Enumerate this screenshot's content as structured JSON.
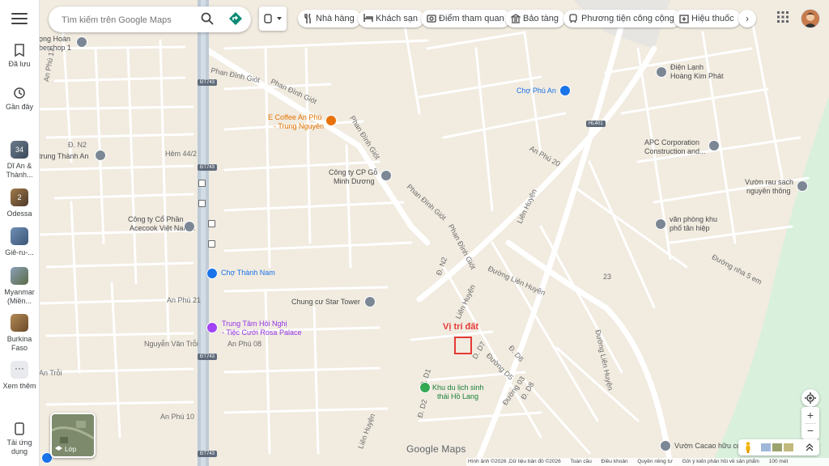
{
  "search": {
    "placeholder": "Tìm kiếm trên Google Maps"
  },
  "rail": {
    "saved": "Đã lưu",
    "recent": "Gần đây",
    "places": [
      {
        "label": "Dĩ An & Thành...",
        "badge": "34"
      },
      {
        "label": "Odessa",
        "badge": "2"
      },
      {
        "label": "Giê-ru-...",
        "badge": ""
      },
      {
        "label": "Myanmar (Miền...",
        "badge": ""
      },
      {
        "label": "Burkina Faso",
        "badge": ""
      }
    ],
    "more": "Xem thêm",
    "download": "Tải ứng dụng"
  },
  "chips": [
    {
      "label": "Nhà hàng",
      "icon": "restaurant-icon"
    },
    {
      "label": "Khách sạn",
      "icon": "hotel-icon"
    },
    {
      "label": "Điểm tham quan",
      "icon": "camera-icon"
    },
    {
      "label": "Bảo tàng",
      "icon": "museum-icon"
    },
    {
      "label": "Phương tiện công cộng",
      "icon": "transit-icon"
    },
    {
      "label": "Hiệu thuốc",
      "icon": "pharmacy-icon"
    }
  ],
  "map_labels": {
    "hoan": "ọng Hoàn",
    "barbershop": "bershop 1",
    "anphu17": "An Phú 17",
    "phandinhgiot1": "Phan Đình Giót",
    "phandinhgiot2": "Phan Đình Giót",
    "phandinhgiot3": "Phan Đình Giót",
    "phandinhgiot4": "Phan Đình Giót",
    "phandinhgiot5": "Phan Đình Giót",
    "ecoffee": "E Coffee An Phú",
    "trungnguyen": "- Trung Nguyên",
    "chophuan": "Chợ Phú An",
    "dienlanh1": "Điện Lạnh",
    "dienlanh2": "Hoàng Kim Phát",
    "dn2a": "Đ. N2",
    "trungthanhan": "trung Thành An",
    "hem442": "Hẻm 44/2",
    "congtycpgo1": "Công ty CP Gỗ",
    "congtycpgo2": "Minh Dương",
    "anphu20": "An Phú 20",
    "apc1": "APC Corporation",
    "apc2": "Construction and...",
    "vuonrau1": "Vườn rau sạch",
    "vuonrau2": "nguyên thông",
    "acecook1": "Công ty Cổ Phần",
    "acecook2": "Acecook Việt Nam...",
    "lienhuyen1": "Liên Huyện",
    "vanphong1": "văn phòng khu",
    "vanphong2": "phố tân hiệp",
    "chothanhnam": "Chợ Thành Nam",
    "dn2b": "Đ. N2",
    "duonglienhuyen1": "Đường Liên Huyện",
    "lienhuyen2": "Liên Huyện",
    "duongnha5em": "Đường nha 5 em",
    "road23": "23",
    "startower": "Chung cư Star Tower",
    "anphu21": "An Phú 21",
    "trungtam1": "Trung Tâm Hội Nghị",
    "trungtam2": "- Tiệc Cưới Rosa Palace",
    "nguyenvantroi1": "Nguyễn Văn Trỗi",
    "anphu08": "An Phú 08",
    "duonglienhuyen2": "Đường Liên Huyện",
    "vitridat": "Vị trí đất",
    "d7": "D. D7",
    "d6": "Đ. D6",
    "d1": "Đ. D1",
    "duongd5": "Đường D5",
    "duong03": "Đường 03",
    "d2": "Đ. D2",
    "d8": "Đ. D8",
    "khudulich1": "Khu du lịch sinh",
    "khudulich2": "thái Hồ Lang",
    "antroi": "An Trỗi",
    "anphu10": "An Phú 10",
    "lienhuyen3": "Liên Huyện",
    "vuoncacao": "Vườn Cacao hữu cơ",
    "dt743a": "ĐT743",
    "dt743b": "ĐT743",
    "dt743c": "ĐT743",
    "dt743d": "ĐT743",
    "hl401": "HL401"
  },
  "layers": {
    "label": "Lớp"
  },
  "logo": "Google Maps",
  "bottom_bar": {
    "imagery": "Hình ảnh ©2026 ,Dữ liệu bản đồ ©2026",
    "all": "Toàn cầu",
    "terms": "Điều khoản",
    "privacy": "Quyền riêng tư",
    "feedback": "Gửi ý kiến phản hồi về sản phẩm",
    "scale": "100 mét"
  }
}
